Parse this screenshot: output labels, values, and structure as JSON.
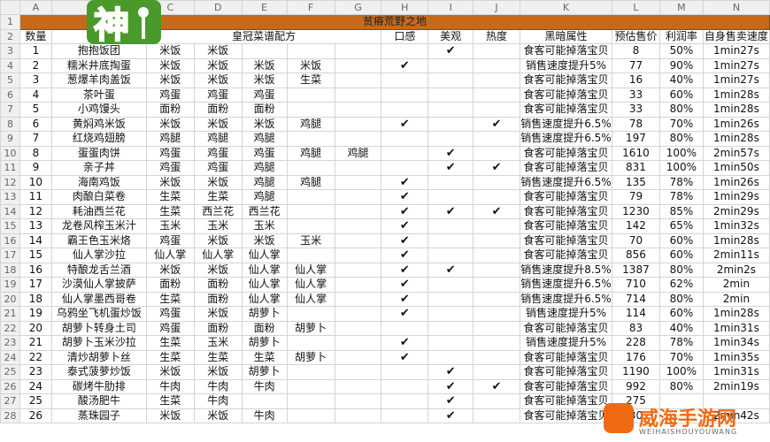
{
  "columns": [
    "A",
    "B",
    "C",
    "D",
    "E",
    "F",
    "G",
    "H",
    "I",
    "J",
    "K",
    "L",
    "M",
    "N"
  ],
  "title": "贫瘠荒野之地",
  "headers": [
    "数量",
    "菜名",
    "皇冠菜谱配方",
    "口感",
    "美观",
    "热度",
    "黑暗属性",
    "预估售价",
    "利润率",
    "自身售卖速度"
  ],
  "check": "✔",
  "rows": [
    {
      "n": "1",
      "name": "抱抱饭团",
      "i1": "米饭",
      "i2": "米饭",
      "i3": "",
      "i4": "",
      "i5": "",
      "taste": false,
      "look": true,
      "heat": false,
      "dark": "食客可能掉落宝贝",
      "price": "8",
      "margin": "50%",
      "speed": "1min27s"
    },
    {
      "n": "2",
      "name": "糯米井底掏蛋",
      "i1": "米饭",
      "i2": "米饭",
      "i3": "米饭",
      "i4": "米饭",
      "i5": "",
      "taste": true,
      "look": false,
      "heat": false,
      "dark": "销售速度提升5%",
      "price": "77",
      "margin": "90%",
      "speed": "1min27s"
    },
    {
      "n": "3",
      "name": "葱爆羊肉盖饭",
      "i1": "米饭",
      "i2": "米饭",
      "i3": "米饭",
      "i4": "生菜",
      "i5": "",
      "taste": false,
      "look": false,
      "heat": false,
      "dark": "食客可能掉落宝贝",
      "price": "16",
      "margin": "40%",
      "speed": "1min27s"
    },
    {
      "n": "4",
      "name": "茶叶蛋",
      "i1": "鸡蛋",
      "i2": "鸡蛋",
      "i3": "鸡蛋",
      "i4": "",
      "i5": "",
      "taste": false,
      "look": false,
      "heat": false,
      "dark": "食客可能掉落宝贝",
      "price": "33",
      "margin": "60%",
      "speed": "1min28s"
    },
    {
      "n": "5",
      "name": "小鸡馒头",
      "i1": "面粉",
      "i2": "面粉",
      "i3": "面粉",
      "i4": "",
      "i5": "",
      "taste": false,
      "look": false,
      "heat": false,
      "dark": "食客可能掉落宝贝",
      "price": "33",
      "margin": "80%",
      "speed": "1min28s"
    },
    {
      "n": "6",
      "name": "黄焖鸡米饭",
      "i1": "米饭",
      "i2": "米饭",
      "i3": "米饭",
      "i4": "鸡腿",
      "i5": "",
      "taste": true,
      "look": false,
      "heat": true,
      "dark": "销售速度提升6.5%",
      "price": "78",
      "margin": "70%",
      "speed": "1min26s"
    },
    {
      "n": "7",
      "name": "红烧鸡翅膀",
      "i1": "鸡腿",
      "i2": "鸡腿",
      "i3": "鸡腿",
      "i4": "",
      "i5": "",
      "taste": false,
      "look": false,
      "heat": false,
      "dark": "销售速度提升6.5%",
      "price": "197",
      "margin": "80%",
      "speed": "1min28s"
    },
    {
      "n": "8",
      "name": "蛋蛋肉饼",
      "i1": "鸡蛋",
      "i2": "鸡蛋",
      "i3": "鸡蛋",
      "i4": "鸡腿",
      "i5": "鸡腿",
      "taste": false,
      "look": true,
      "heat": false,
      "dark": "食客可能掉落宝贝",
      "price": "1610",
      "margin": "100%",
      "speed": "2min57s"
    },
    {
      "n": "9",
      "name": "亲子丼",
      "i1": "鸡蛋",
      "i2": "鸡蛋",
      "i3": "鸡腿",
      "i4": "",
      "i5": "",
      "taste": false,
      "look": true,
      "heat": true,
      "dark": "食客可能掉落宝贝",
      "price": "831",
      "margin": "100%",
      "speed": "1min50s"
    },
    {
      "n": "10",
      "name": "海南鸡饭",
      "i1": "米饭",
      "i2": "米饭",
      "i3": "鸡腿",
      "i4": "鸡腿",
      "i5": "",
      "taste": true,
      "look": false,
      "heat": false,
      "dark": "销售速度提升6.5%",
      "price": "135",
      "margin": "78%",
      "speed": "1min26s"
    },
    {
      "n": "11",
      "name": "肉酿白菜卷",
      "i1": "生菜",
      "i2": "生菜",
      "i3": "鸡腿",
      "i4": "",
      "i5": "",
      "taste": true,
      "look": false,
      "heat": false,
      "dark": "食客可能掉落宝贝",
      "price": "79",
      "margin": "78%",
      "speed": "1min29s"
    },
    {
      "n": "12",
      "name": "耗油西兰花",
      "i1": "生菜",
      "i2": "西兰花",
      "i3": "西兰花",
      "i4": "",
      "i5": "",
      "taste": true,
      "look": true,
      "heat": true,
      "dark": "食客可能掉落宝贝",
      "price": "1230",
      "margin": "85%",
      "speed": "2min29s"
    },
    {
      "n": "13",
      "name": "龙卷风榨玉米汁",
      "i1": "玉米",
      "i2": "玉米",
      "i3": "玉米",
      "i4": "",
      "i5": "",
      "taste": true,
      "look": false,
      "heat": false,
      "dark": "食客可能掉落宝贝",
      "price": "142",
      "margin": "65%",
      "speed": "1min32s"
    },
    {
      "n": "14",
      "name": "霸王色玉米烙",
      "i1": "鸡蛋",
      "i2": "米饭",
      "i3": "米饭",
      "i4": "玉米",
      "i5": "",
      "taste": true,
      "look": false,
      "heat": false,
      "dark": "食客可能掉落宝贝",
      "price": "70",
      "margin": "60%",
      "speed": "1min28s"
    },
    {
      "n": "15",
      "name": "仙人掌沙拉",
      "i1": "仙人掌",
      "i2": "仙人掌",
      "i3": "仙人掌",
      "i4": "",
      "i5": "",
      "taste": true,
      "look": false,
      "heat": false,
      "dark": "食客可能掉落宝贝",
      "price": "856",
      "margin": "60%",
      "speed": "2min11s"
    },
    {
      "n": "16",
      "name": "特酿龙舌兰酒",
      "i1": "米饭",
      "i2": "米饭",
      "i3": "仙人掌",
      "i4": "仙人掌",
      "i5": "",
      "taste": true,
      "look": true,
      "heat": false,
      "dark": "销售速度提升8.5%",
      "price": "1387",
      "margin": "80%",
      "speed": "2min2s"
    },
    {
      "n": "17",
      "name": "沙漠仙人掌披萨",
      "i1": "面粉",
      "i2": "面粉",
      "i3": "仙人掌",
      "i4": "仙人掌",
      "i5": "",
      "taste": true,
      "look": false,
      "heat": false,
      "dark": "销售速度提升6.5%",
      "price": "710",
      "margin": "62%",
      "speed": "2min"
    },
    {
      "n": "18",
      "name": "仙人掌墨西哥卷",
      "i1": "生菜",
      "i2": "面粉",
      "i3": "仙人掌",
      "i4": "仙人掌",
      "i5": "",
      "taste": true,
      "look": false,
      "heat": false,
      "dark": "销售速度提升6.5%",
      "price": "714",
      "margin": "80%",
      "speed": "2min"
    },
    {
      "n": "19",
      "name": "乌鸦坐飞机蛋炒饭",
      "i1": "鸡蛋",
      "i2": "米饭",
      "i3": "胡萝卜",
      "i4": "",
      "i5": "",
      "taste": true,
      "look": false,
      "heat": false,
      "dark": "销售速度提升5%",
      "price": "114",
      "margin": "60%",
      "speed": "1min28s"
    },
    {
      "n": "20",
      "name": "胡萝卜转身土司",
      "i1": "鸡蛋",
      "i2": "面粉",
      "i3": "面粉",
      "i4": "胡萝卜",
      "i5": "",
      "taste": false,
      "look": false,
      "heat": false,
      "dark": "食客可能掉落宝贝",
      "price": "83",
      "margin": "40%",
      "speed": "1min31s"
    },
    {
      "n": "21",
      "name": "胡萝卜玉米沙拉",
      "i1": "生菜",
      "i2": "玉米",
      "i3": "胡萝卜",
      "i4": "",
      "i5": "",
      "taste": true,
      "look": false,
      "heat": false,
      "dark": "销售速度提升5%",
      "price": "228",
      "margin": "78%",
      "speed": "1min34s"
    },
    {
      "n": "22",
      "name": "清炒胡萝卜丝",
      "i1": "生菜",
      "i2": "生菜",
      "i3": "生菜",
      "i4": "胡萝卜",
      "i5": "",
      "taste": true,
      "look": false,
      "heat": false,
      "dark": "食客可能掉落宝贝",
      "price": "176",
      "margin": "70%",
      "speed": "1min35s"
    },
    {
      "n": "23",
      "name": "泰式菠萝炒饭",
      "i1": "米饭",
      "i2": "米饭",
      "i3": "胡萝卜",
      "i4": "",
      "i5": "",
      "taste": false,
      "look": true,
      "heat": false,
      "dark": "食客可能掉落宝贝",
      "price": "1190",
      "margin": "100%",
      "speed": "1min31s"
    },
    {
      "n": "24",
      "name": "碳烤牛肋排",
      "i1": "牛肉",
      "i2": "牛肉",
      "i3": "牛肉",
      "i4": "",
      "i5": "",
      "taste": false,
      "look": true,
      "heat": true,
      "dark": "食客可能掉落宝贝",
      "price": "992",
      "margin": "80%",
      "speed": "2min19s"
    },
    {
      "n": "25",
      "name": "酸汤肥牛",
      "i1": "生菜",
      "i2": "牛肉",
      "i3": "",
      "i4": "",
      "i5": "",
      "taste": false,
      "look": true,
      "heat": false,
      "dark": "食客可能掉落宝贝",
      "price": "275",
      "margin": "",
      "speed": ""
    },
    {
      "n": "26",
      "name": "蒸珠园子",
      "i1": "米饭",
      "i2": "米饭",
      "i3": "牛肉",
      "i4": "",
      "i5": "",
      "taste": false,
      "look": true,
      "heat": false,
      "dark": "食客可能掉落宝贝",
      "price": "30",
      "margin": "",
      "speed": "2min42s"
    }
  ],
  "logo": {
    "char": "神",
    "colors": [
      "#f3c61b",
      "#4a9a2b",
      "#ffffff"
    ]
  },
  "watermark": {
    "text": "威海手游网",
    "sub": "WEIHAISHOUYOUWANG",
    "color": "#f06a14"
  }
}
